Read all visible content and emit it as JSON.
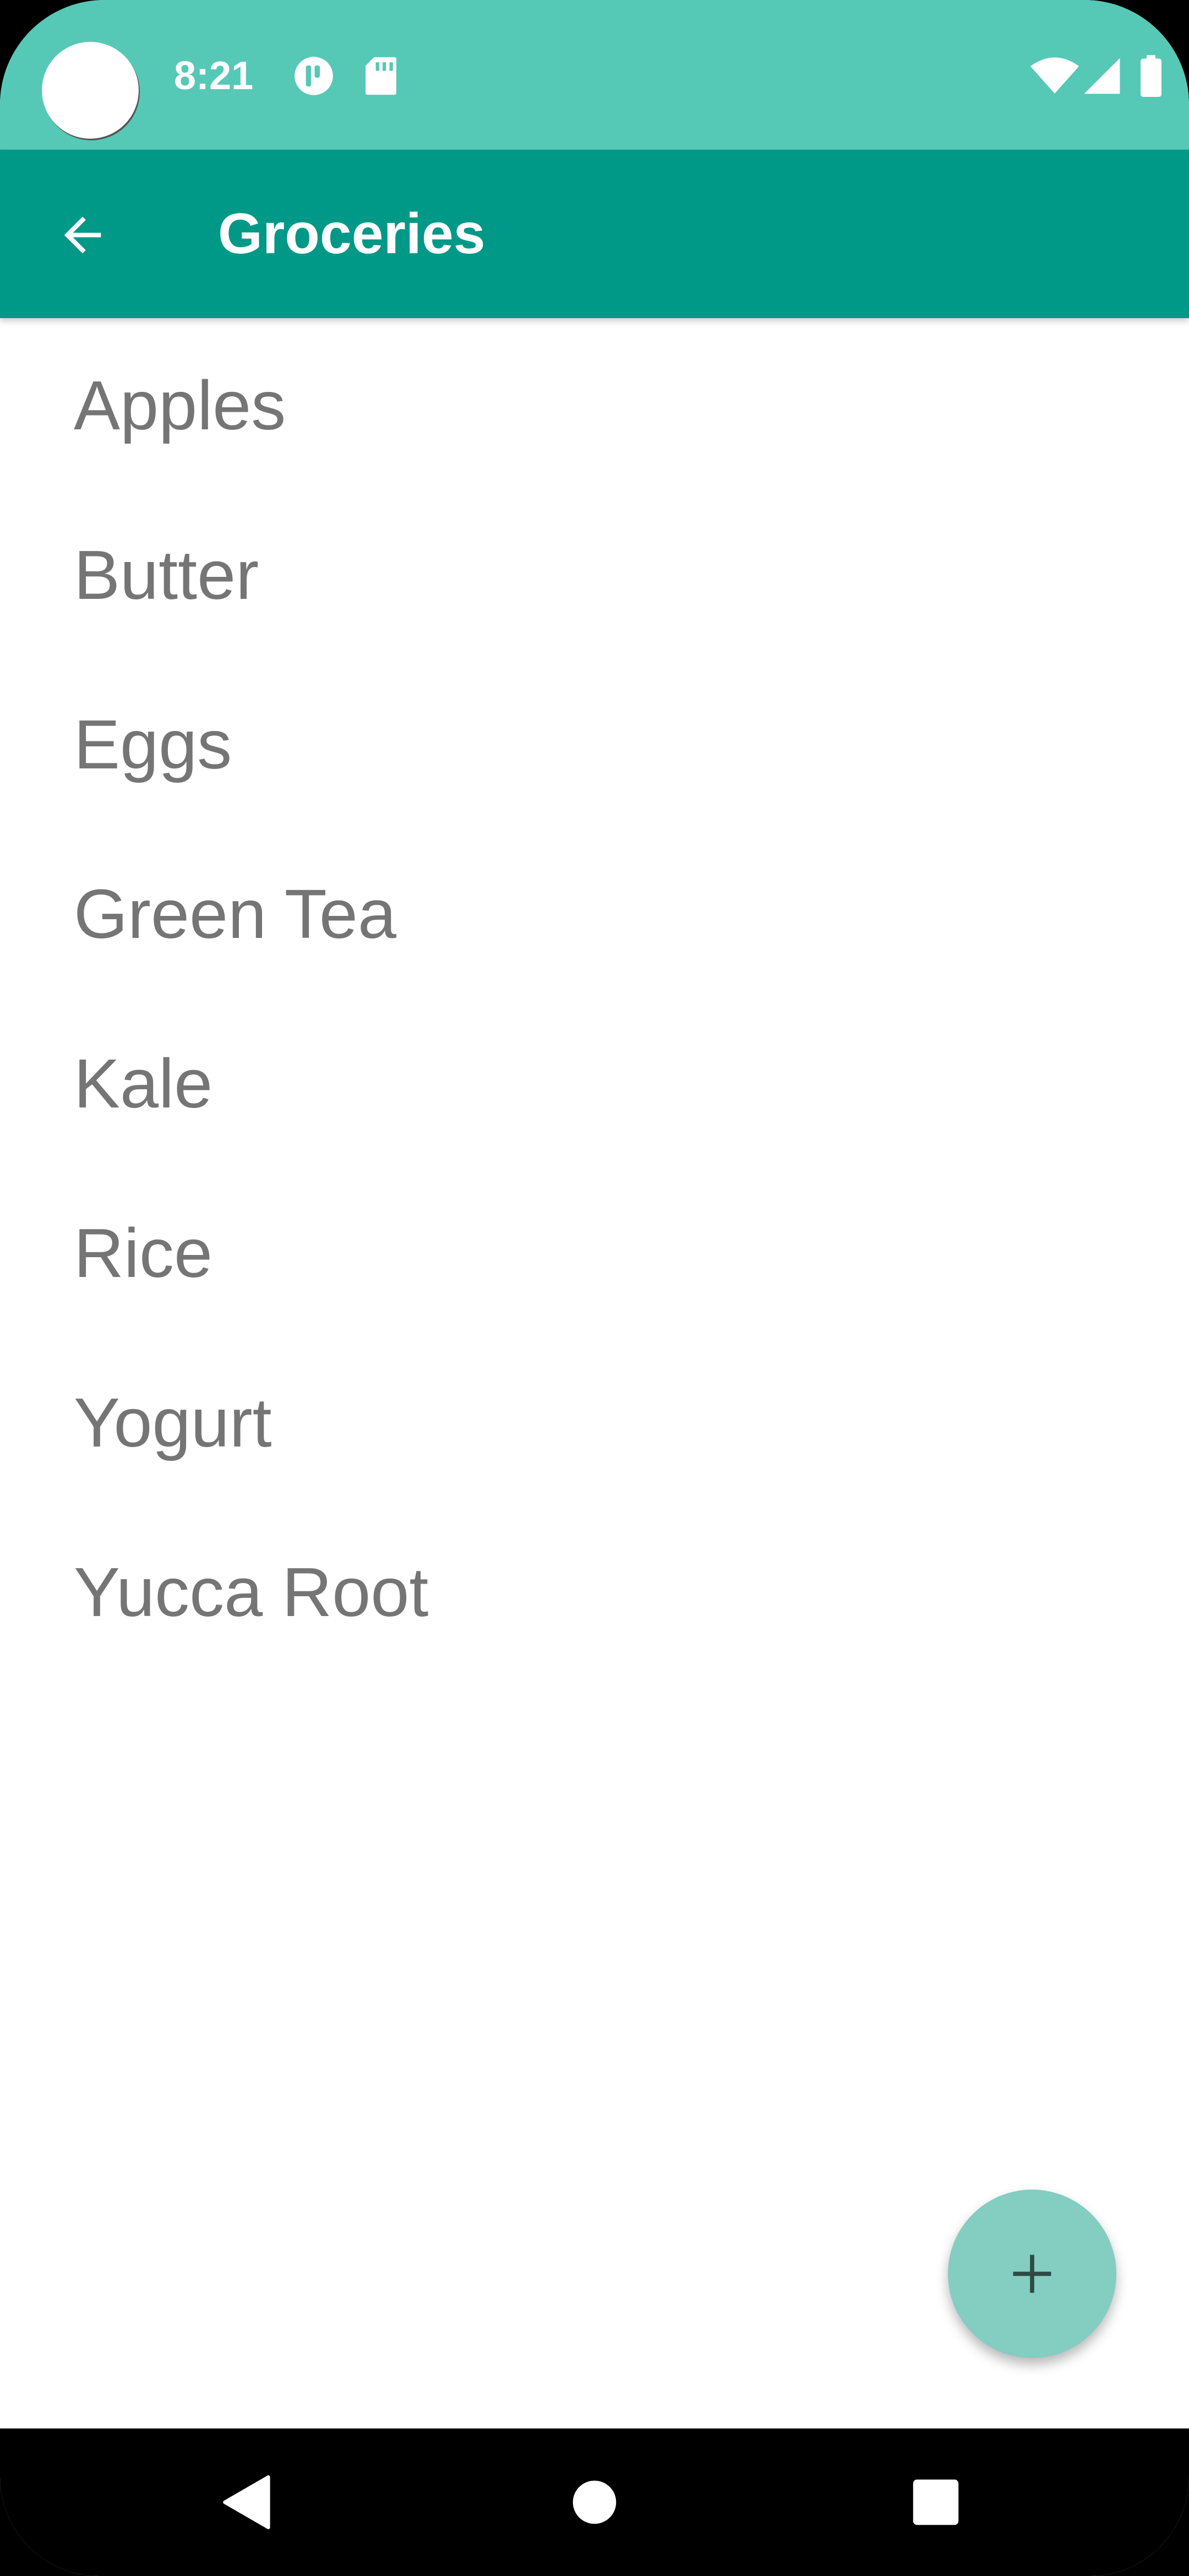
{
  "status_bar": {
    "time": "8:21",
    "icons": [
      "notification-icon",
      "sd-card-icon",
      "wifi-icon",
      "signal-icon",
      "battery-icon"
    ]
  },
  "app_bar": {
    "title": "Groceries",
    "back_icon": "arrow-back-icon"
  },
  "list": {
    "items": [
      "Apples",
      "Butter",
      "Eggs",
      "Green Tea",
      "Kale",
      "Rice",
      "Yogurt",
      "Yucca Root"
    ]
  },
  "fab": {
    "icon": "add-icon"
  },
  "nav_bar": {
    "icons": [
      "back-triangle-icon",
      "home-circle-icon",
      "recents-square-icon"
    ]
  },
  "colors": {
    "status_bar": "#56c8b6",
    "app_bar": "#009887",
    "fab": "#83cdc1",
    "list_text": "#757575"
  }
}
